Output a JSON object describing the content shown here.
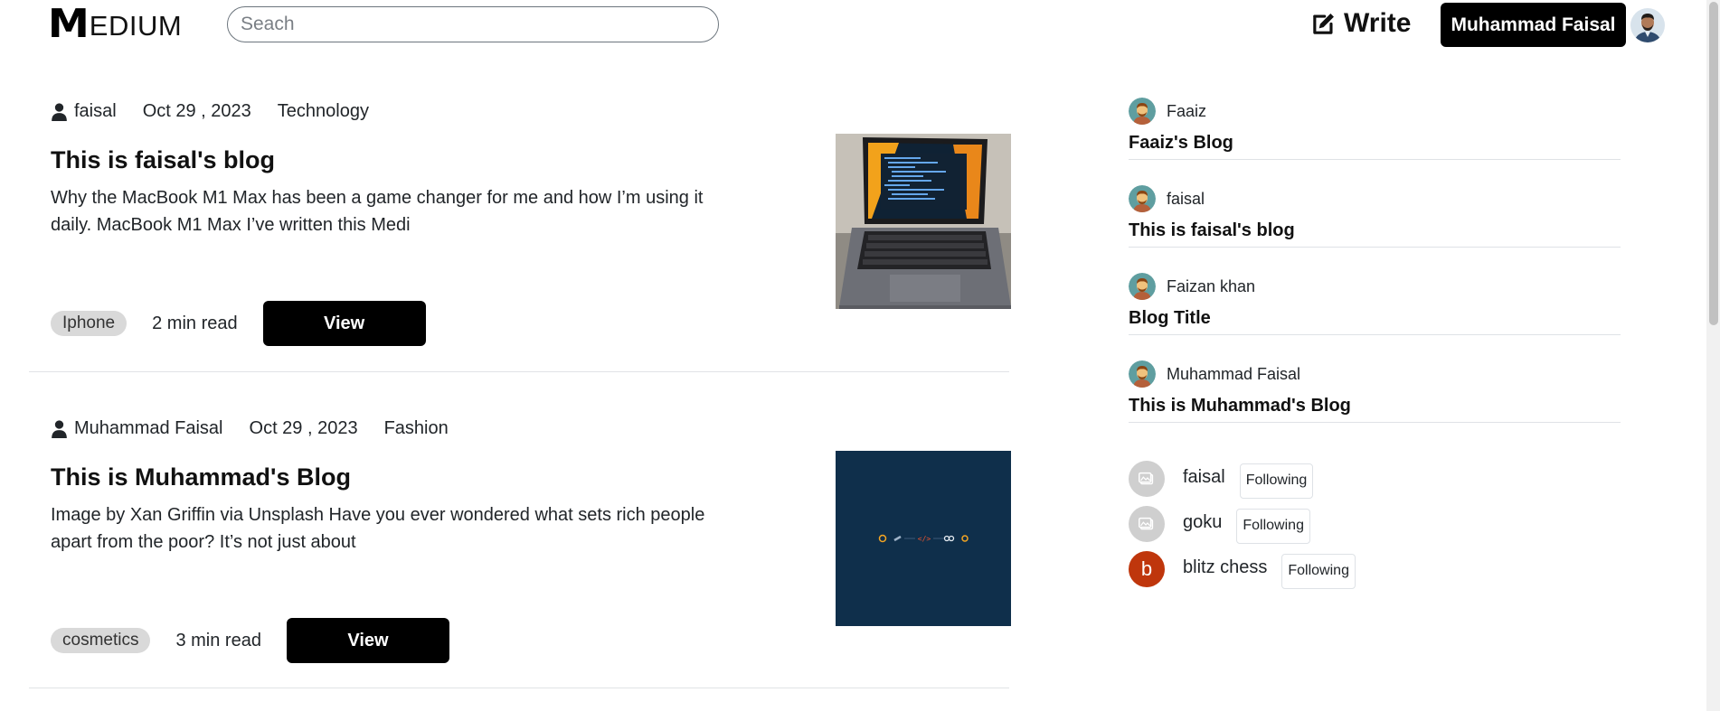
{
  "header": {
    "logo_mark": "M",
    "logo_text": "EDIUM",
    "search_placeholder": "Seach",
    "write_label": "Write",
    "user_button": "Muhammad Faisal"
  },
  "posts": [
    {
      "author": "faisal",
      "date": "Oct 29 , 2023",
      "category": "Technology",
      "title": "This is faisal's blog",
      "excerpt": "Why the MacBook M1 Max has been a game changer for me and how I’m using it daily. MacBook M1 Max I’ve written this Medi",
      "tag": "Iphone",
      "read_time": "2 min read",
      "view_label": "View"
    },
    {
      "author": "Muhammad Faisal",
      "date": "Oct 29 , 2023",
      "category": "Fashion",
      "title": "This is Muhammad's Blog",
      "excerpt": "Image by Xan Griffin via Unsplash Have you ever wondered what sets rich people apart from the poor? It’s not just about",
      "tag": "cosmetics",
      "read_time": "3 min read",
      "view_label": "View"
    }
  ],
  "sidebar": {
    "recent": [
      {
        "author": "Faaiz",
        "title": "Faaiz's Blog"
      },
      {
        "author": "faisal",
        "title": "This is faisal's blog"
      },
      {
        "author": "Faizan khan",
        "title": "Blog Title"
      },
      {
        "author": "Muhammad Faisal",
        "title": "This is Muhammad's Blog"
      }
    ],
    "following": [
      {
        "name": "faisal",
        "button": "Following",
        "avatar": "image-placeholder-icon"
      },
      {
        "name": "goku",
        "button": "Following",
        "avatar": "image-placeholder-icon"
      },
      {
        "name": "blitz chess",
        "initial": "b",
        "button": "Following",
        "avatar_color": "#bf360c"
      }
    ]
  }
}
